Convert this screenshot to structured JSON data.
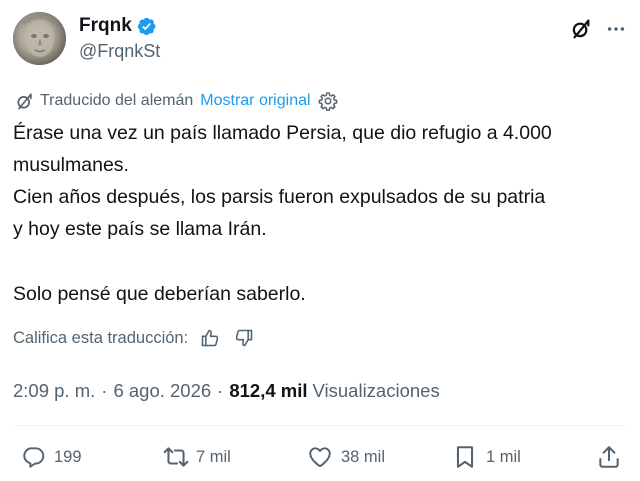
{
  "author": {
    "display_name": "Frqnk",
    "handle": "@FrqnkSt",
    "verified": true
  },
  "header": {
    "grok_icon": "grok-slash-icon",
    "more_icon": "more-dots-icon"
  },
  "translation": {
    "label": "Traducido del alemán",
    "show_original": "Mostrar original",
    "settings_icon": "gear-icon"
  },
  "tweet": {
    "lines": [
      "Érase una vez un país llamado Persia, que dio refugio a 4.000",
      "musulmanes.",
      "Cien años después, los parsis fueron expulsados de su patria",
      "y hoy este país se llama Irán.",
      "Solo pensé que deberían saberlo."
    ]
  },
  "rate": {
    "label": "Califica esta traducción:",
    "thumbs_up_icon": "thumbs-up-icon",
    "thumbs_down_icon": "thumbs-down-icon"
  },
  "meta": {
    "time": "2:09 p. m.",
    "separator": "·",
    "date": "6 ago. 2026",
    "views_count": "812,4 mil",
    "views_label": "Visualizaciones"
  },
  "actions": {
    "replies": "199",
    "reposts": "7 mil",
    "likes": "38 mil",
    "bookmarks": "1 mil"
  },
  "colors": {
    "text": "#0f1419",
    "secondary": "#536471",
    "link": "#1d9bf0",
    "verified": "#1d9bf0"
  }
}
